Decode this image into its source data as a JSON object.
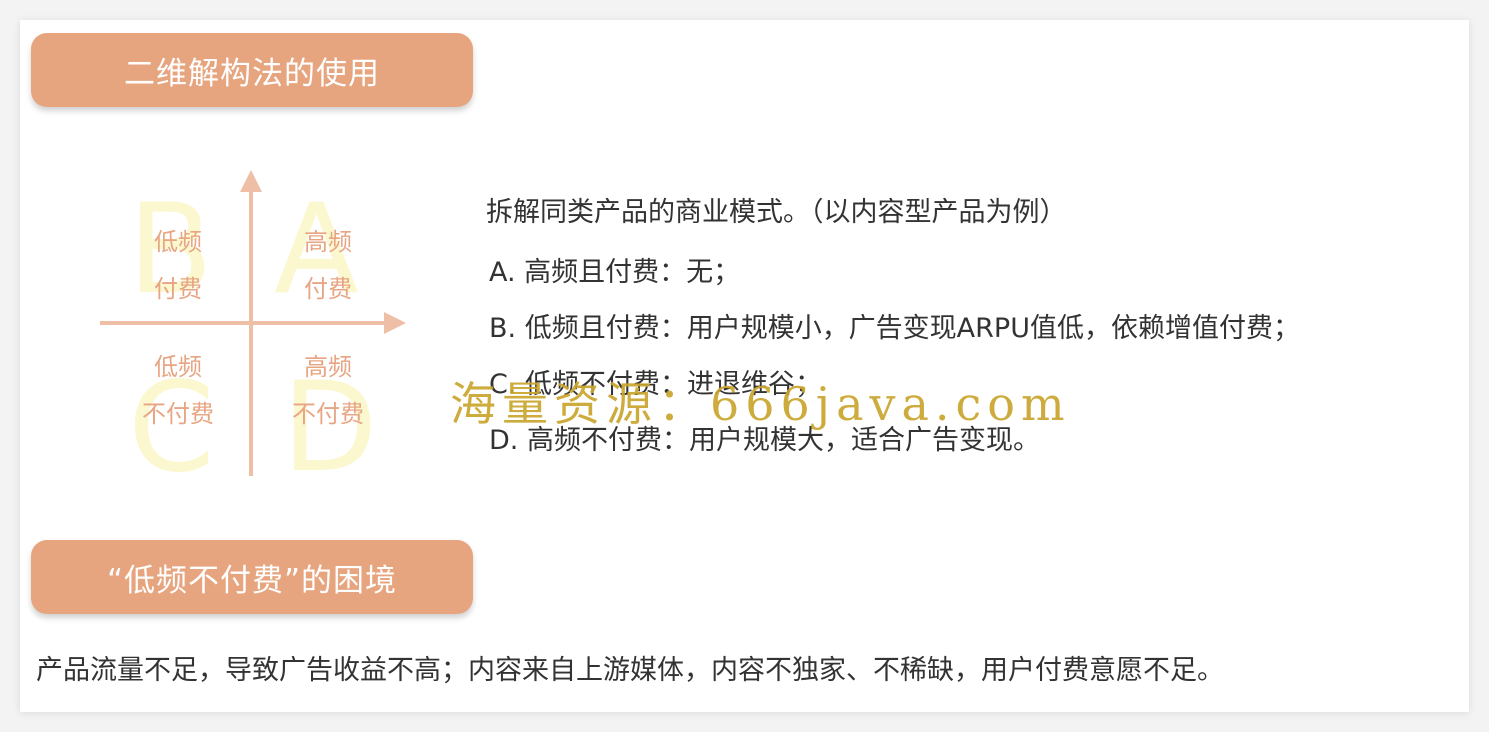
{
  "section1": {
    "title": "二维解构法的使用"
  },
  "quadrant": {
    "letters": {
      "b": "B",
      "a": "A",
      "c": "C",
      "d": "D"
    },
    "b_top": "低频",
    "b_bottom": "付费",
    "a_top": "高频",
    "a_bottom": "付费",
    "c_top": "低频",
    "c_bottom": "不付费",
    "d_top": "高频",
    "d_bottom": "不付费",
    "axis_color": "#eebfa6",
    "letter_color": "#fbf7cf"
  },
  "description": {
    "intro": "拆解同类产品的商业模式。（以内容型产品为例）",
    "options": [
      "A. 高频且付费：无；",
      "B. 低频且付费：用户规模小，广告变现ARPU值低，依赖增值付费；",
      "C. 低频不付费：进退维谷；",
      "D. 高频不付费：用户规模大，适合广告变现。"
    ]
  },
  "watermark": "海量资源：666java.com",
  "section2": {
    "title": "“低频不付费”的困境"
  },
  "bottom_text": "产品流量不足，导致广告收益不高；内容来自上游媒体，内容不独家、不稀缺，用户付费意愿不足。",
  "colors": {
    "accent": "#e7a57f",
    "watermark": "#c9a52d"
  }
}
